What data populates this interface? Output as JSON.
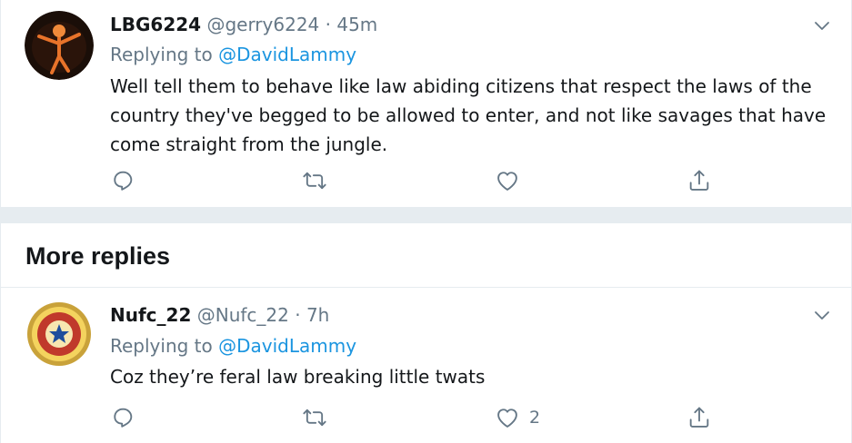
{
  "colors": {
    "text": "#14171a",
    "secondary": "#657786",
    "link": "#1b95e0",
    "divider": "#e6ecf0"
  },
  "tweets": [
    {
      "display_name": "LBG6224",
      "handle": "@gerry6224",
      "separator": " · ",
      "time": "45m",
      "replying_prefix": "Replying to ",
      "replying_to": "@DavidLammy",
      "text": "Well tell them to behave like law abiding citizens that respect the laws of the country they've begged to be allowed to enter, and not like savages that have come straight from the jungle.",
      "like_count": ""
    },
    {
      "display_name": "Nufc_22",
      "handle": "@Nufc_22",
      "separator": " · ",
      "time": "7h",
      "replying_prefix": "Replying to ",
      "replying_to": "@DavidLammy",
      "text": "Coz they’re feral law breaking little twats",
      "like_count": "2"
    }
  ],
  "section": {
    "more_replies_title": "More replies"
  },
  "icons": {
    "reply": "reply-icon",
    "retweet": "retweet-icon",
    "like": "heart-icon",
    "share": "share-icon",
    "caret": "chevron-down-icon"
  }
}
